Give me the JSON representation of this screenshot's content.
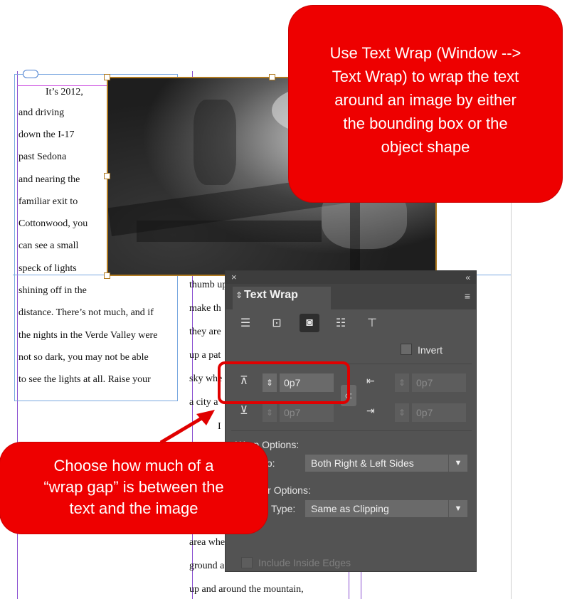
{
  "callout_top": {
    "lines": [
      "Use Text Wrap (Window -->",
      "Text Wrap) to wrap the text",
      "around an image by either",
      "the bounding box or the",
      "object shape"
    ]
  },
  "callout_bottom": {
    "lines": [
      "Choose how much of a",
      "“wrap gap” is between the",
      "text and the image"
    ]
  },
  "story_left": {
    "lines": [
      "It’s 2012,",
      "and driving",
      "down the I-17",
      "past Sedona",
      "and nearing the",
      "familiar exit to",
      "Cottonwood, you",
      "can see a small",
      "speck of lights",
      "shining off in the",
      "distance. There’s not much, and if",
      "the nights in the Verde Valley were",
      "not so dark, you may not be able",
      "to see the lights at all. Raise your"
    ]
  },
  "story_right": {
    "lines": [
      "thumb up to the space and you can",
      "make th",
      "they are",
      "up a pat",
      "sky whe",
      "a city a",
      "I",
      "",
      "area whe",
      "ground a",
      "up and around the mountain,"
    ]
  },
  "panel": {
    "title": "Text Wrap",
    "close_glyph": "×",
    "collapse_glyph": "«",
    "menu_glyph": "≡",
    "invert_label": "Invert",
    "top_offset": "0p7",
    "bottom_offset": "0p7",
    "left_offset": "0p7",
    "right_offset": "0p7",
    "wrap_options_label": "Wrap Options:",
    "wrap_to_label": "Wrap To:",
    "wrap_to_value": "Both Right & Left Sides",
    "contour_options_label": "Contour Options:",
    "type_label": "Type:",
    "type_value": "Same as Clipping",
    "include_inside_edges_label": "Include Inside Edges"
  },
  "colors": {
    "callout": "#ee0000",
    "panel": "#535353",
    "highlight": "#e00000",
    "frame": "#b07a20",
    "guide": "#8a4fd0"
  }
}
